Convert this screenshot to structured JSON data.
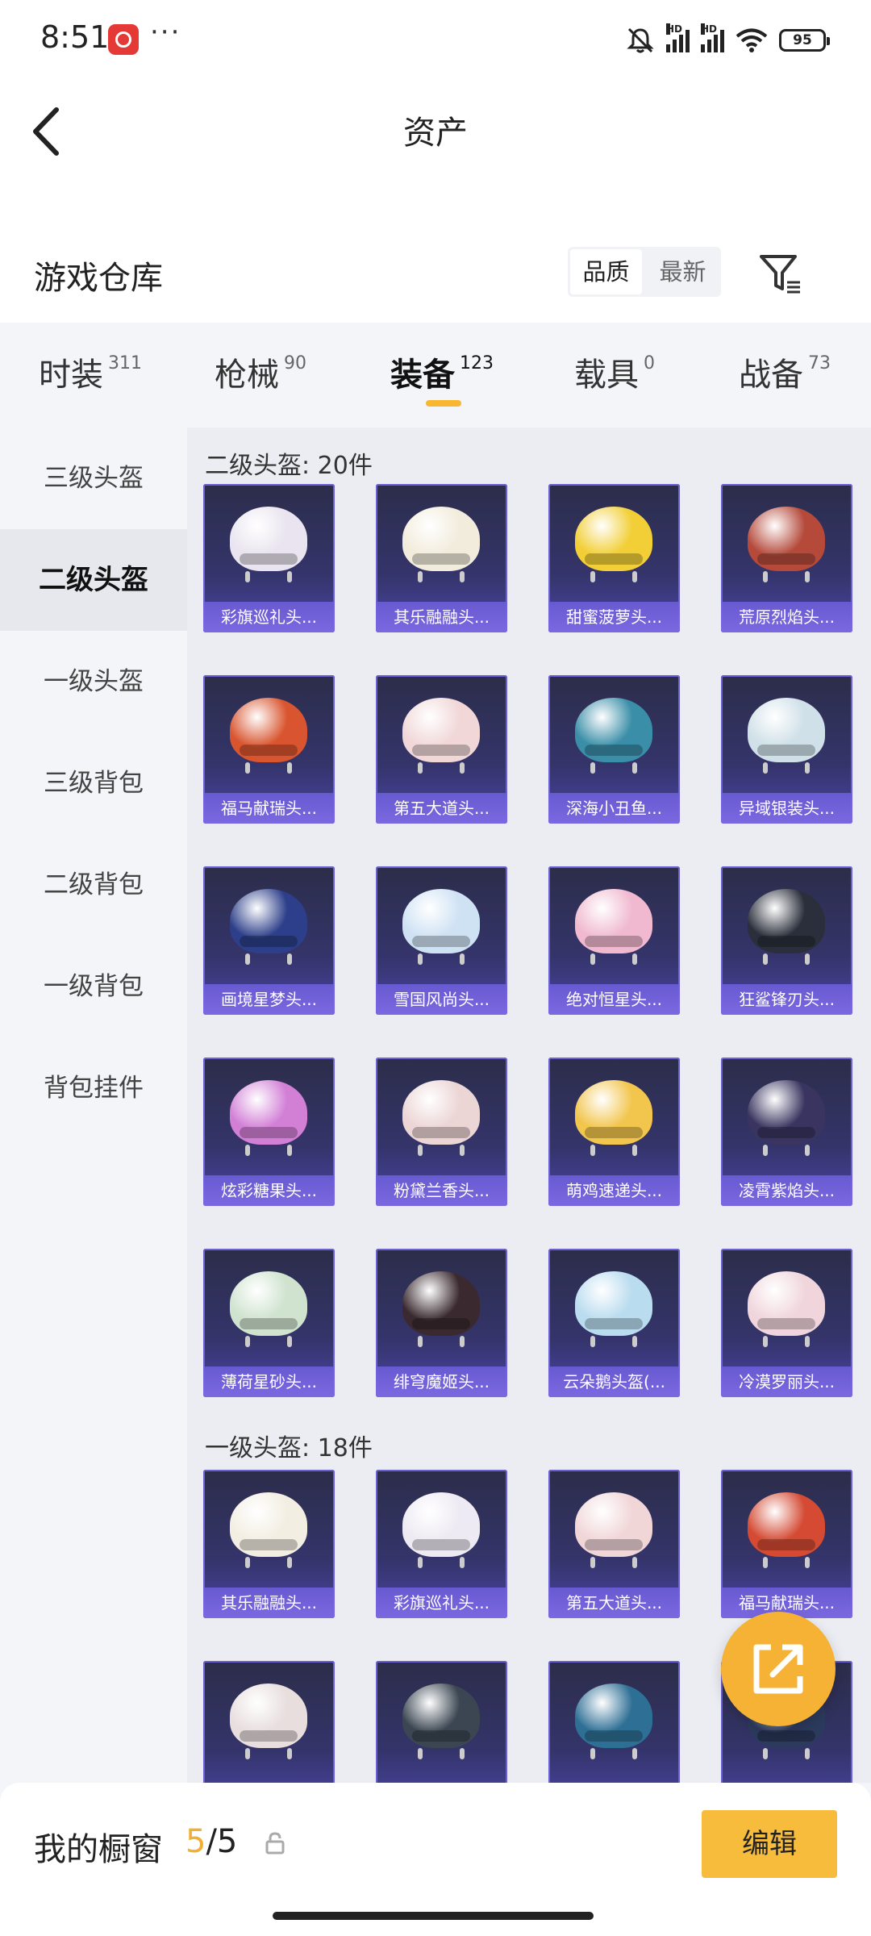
{
  "status_bar": {
    "time": "8:51",
    "more": "···",
    "hd1": "HD",
    "hd2": "HD",
    "battery": "95"
  },
  "header": {
    "title": "资产"
  },
  "warehouse": {
    "title": "游戏仓库",
    "sort_options": [
      "品质",
      "最新"
    ],
    "sort_selected": "品质"
  },
  "tabs": [
    {
      "label": "时装",
      "count": "311"
    },
    {
      "label": "枪械",
      "count": "90"
    },
    {
      "label": "装备",
      "count": "123"
    },
    {
      "label": "载具",
      "count": "0"
    },
    {
      "label": "战备",
      "count": "73"
    }
  ],
  "active_tab": "装备",
  "sidebar": {
    "items": [
      "三级头盔",
      "二级头盔",
      "一级头盔",
      "三级背包",
      "二级背包",
      "一级背包",
      "背包挂件"
    ],
    "active": "二级头盔"
  },
  "sections": [
    {
      "title": "二级头盔: 20件",
      "items": [
        {
          "label": "彩旗巡礼头...",
          "color": "#e9e4ef"
        },
        {
          "label": "其乐融融头...",
          "color": "#f2ecdc"
        },
        {
          "label": "甜蜜菠萝头...",
          "color": "#f2cf36"
        },
        {
          "label": "荒原烈焰头...",
          "color": "#b54a3b"
        },
        {
          "label": "福马献瑞头...",
          "color": "#d9552f"
        },
        {
          "label": "第五大道头...",
          "color": "#f1d7d8"
        },
        {
          "label": "深海小丑鱼...",
          "color": "#3a8ea8"
        },
        {
          "label": "异域银装头...",
          "color": "#cfe0e8"
        },
        {
          "label": "画境星梦头...",
          "color": "#2d3f8a"
        },
        {
          "label": "雪国风尚头...",
          "color": "#cfe2f4"
        },
        {
          "label": "绝对恒星头...",
          "color": "#f0b9cf"
        },
        {
          "label": "狂鲨锋刃头...",
          "color": "#2a2f3b"
        },
        {
          "label": "炫彩糖果头...",
          "color": "#d27fd6"
        },
        {
          "label": "粉黛兰香头...",
          "color": "#ecd5d5"
        },
        {
          "label": "萌鸡速递头...",
          "color": "#f2c54d"
        },
        {
          "label": "凌霄紫焰头...",
          "color": "#3a3560"
        },
        {
          "label": "薄荷星砂头...",
          "color": "#cfe3cf"
        },
        {
          "label": "绯穹魔姬头...",
          "color": "#3a2a30"
        },
        {
          "label": "云朵鹅头盔(...",
          "color": "#b9dcef"
        },
        {
          "label": "冷漠罗丽头...",
          "color": "#f0d6dc"
        }
      ]
    },
    {
      "title": "一级头盔: 18件",
      "items": [
        {
          "label": "其乐融融头...",
          "color": "#f3eee2"
        },
        {
          "label": "彩旗巡礼头...",
          "color": "#eeeaf3"
        },
        {
          "label": "第五大道头...",
          "color": "#f1d6d8"
        },
        {
          "label": "福马献瑞头...",
          "color": "#d44a33"
        },
        {
          "label": "",
          "color": "#e8dede"
        },
        {
          "label": "",
          "color": "#3b4652"
        },
        {
          "label": "",
          "color": "#2e6f95"
        },
        {
          "label": "",
          "color": "#2c3a5d"
        }
      ]
    }
  ],
  "bottom": {
    "window_label": "我的橱窗",
    "window_current": "5",
    "window_total": "/5",
    "edit_label": "编辑"
  }
}
